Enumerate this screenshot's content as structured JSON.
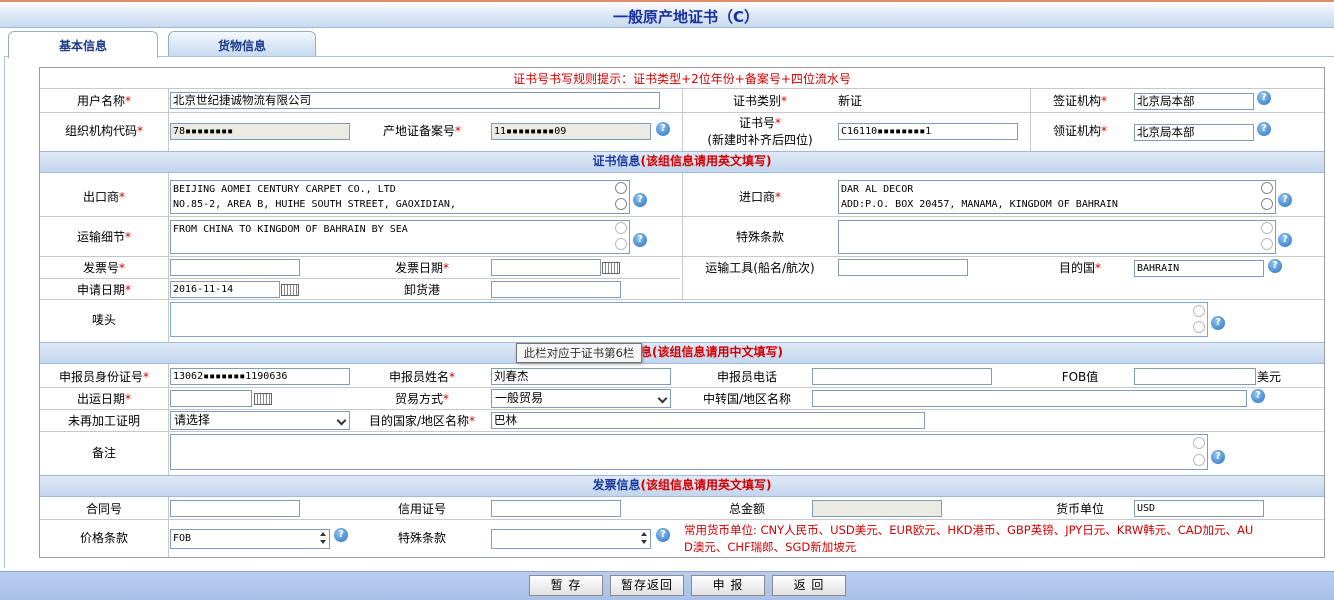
{
  "window": {
    "title": "一般原产地证书（C）"
  },
  "tabs": [
    {
      "label": "基本信息",
      "active": true
    },
    {
      "label": "货物信息",
      "active": false
    }
  ],
  "hint": "证书号书写规则提示：证书类型+2位年份+备案号+四位流水号",
  "basic": {
    "user_name_label": "用户名称",
    "user_name": "北京世纪捷诚物流有限公司",
    "cert_type_label": "证书类别",
    "cert_type": "新证",
    "sign_org_label": "签证机构",
    "sign_org": "北京局本部",
    "org_code_label": "组织机构代码",
    "org_code": "78▪▪▪▪▪▪▪▪",
    "origin_reg_label": "产地证备案号",
    "origin_reg": "11▪▪▪▪▪▪▪▪09",
    "cert_no_label": "证书号",
    "cert_no_sub": "(新建时补齐后四位)",
    "cert_no": "C16110▪▪▪▪▪▪▪▪1",
    "collect_org_label": "领证机构",
    "collect_org": "北京局本部"
  },
  "cert_section": {
    "title_blue": "证书信息",
    "title_red": "(该组信息请用英文填写)"
  },
  "cert": {
    "exporter_label": "出口商",
    "exporter": "BEIJING AOMEI CENTURY CARPET CO., LTD\nNO.85-2, AREA B, HUIHE SOUTH STREET, GAOXIDIAN,",
    "importer_label": "进口商",
    "importer": "DAR AL DECOR\nADD:P.O. BOX 20457, MANAMA, KINGDOM OF BAHRAIN",
    "transport_label": "运输细节",
    "transport": "FROM CHINA TO KINGDOM OF BAHRAIN BY SEA",
    "special_label": "特殊条款",
    "special": "",
    "invoice_no_label": "发票号",
    "invoice_no": "",
    "invoice_date_label": "发票日期",
    "invoice_date": "",
    "vessel_label": "运输工具(船名/航次)",
    "vessel": "",
    "dest_label": "目的国",
    "dest": "BAHRAIN",
    "apply_date_label": "申请日期",
    "apply_date": "2016-11-14",
    "unload_port_label": "卸货港",
    "unload_port": "",
    "mark_label": "唛头",
    "mark": ""
  },
  "tooltip": "此栏对应于证书第6栏",
  "declarant_section": {
    "title_red": "息(该组信息请用中文填写)"
  },
  "decl": {
    "id_label": "申报员身份证号",
    "id_value": "13062▪▪▪▪▪▪▪1190636",
    "name_label": "申报员姓名",
    "name": "刘春杰",
    "phone_label": "申报员电话",
    "phone": "",
    "fob_label": "FOB值",
    "fob": "",
    "fob_unit": "美元",
    "ship_date_label": "出运日期",
    "ship_date": "",
    "trade_label": "贸易方式",
    "trade": "一般贸易",
    "transit_label": "中转国/地区名称",
    "transit": "",
    "processing_label": "未再加工证明",
    "processing": "请选择",
    "dest_name_label": "目的国家/地区名称",
    "dest_name": "巴林",
    "remark_label": "备注",
    "remark": ""
  },
  "invoice_section": {
    "title_blue": "发票信息",
    "title_red": "(该组信息请用英文填写)"
  },
  "inv": {
    "contract_label": "合同号",
    "contract": "",
    "lc_label": "信用证号",
    "lc": "",
    "total_label": "总金额",
    "total": "",
    "currency_label": "货币单位",
    "currency": "USD",
    "price_label": "价格条款",
    "price": "FOB",
    "special_label": "特殊条款",
    "special": "",
    "currency_hint_1": "常用货币单位:  CNY人民币、USD美元、EUR欧元、HKD港币、GBP英镑、JPY日元、KRW韩元、CAD加元、AU",
    "currency_hint_2": "D澳元、CHF瑞郎、SGD新加坡元"
  },
  "buttons": {
    "save": "暂 存",
    "save_return": "暂存返回",
    "declare": "申 报",
    "back": "返 回"
  },
  "colors": {
    "required": "#d40000",
    "section_blue": "#1a3aa0",
    "title": "#1a2fa0"
  }
}
